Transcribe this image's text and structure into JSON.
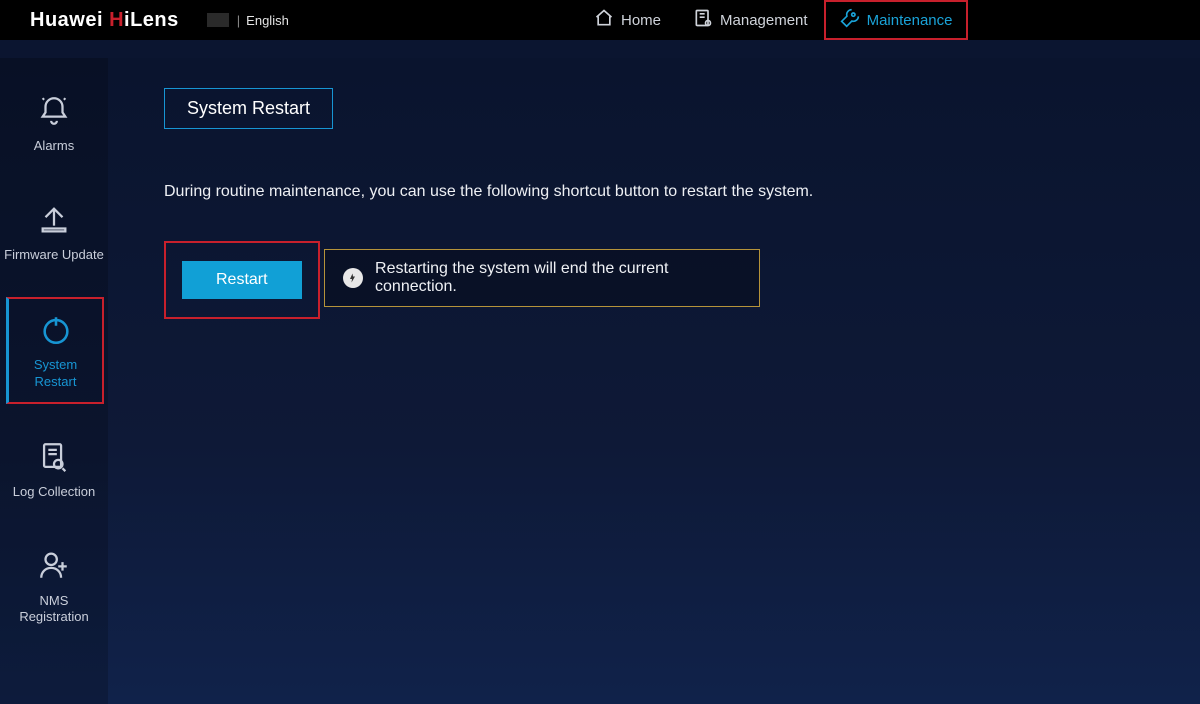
{
  "brand": {
    "prefix": "Huawei ",
    "h": "H",
    "suffix": "iLens"
  },
  "language": "English",
  "topnav": {
    "home": "Home",
    "management": "Management",
    "maintenance": "Maintenance"
  },
  "sidebar": {
    "alarms": "Alarms",
    "firmware": "Firmware Update",
    "restart": "System Restart",
    "log": "Log Collection",
    "nms": "NMS Registration"
  },
  "page": {
    "tab": "System Restart",
    "description": "During routine maintenance, you can use the following shortcut button to restart the system.",
    "restart_btn": "Restart",
    "warning": "Restarting the system will end the current connection."
  }
}
